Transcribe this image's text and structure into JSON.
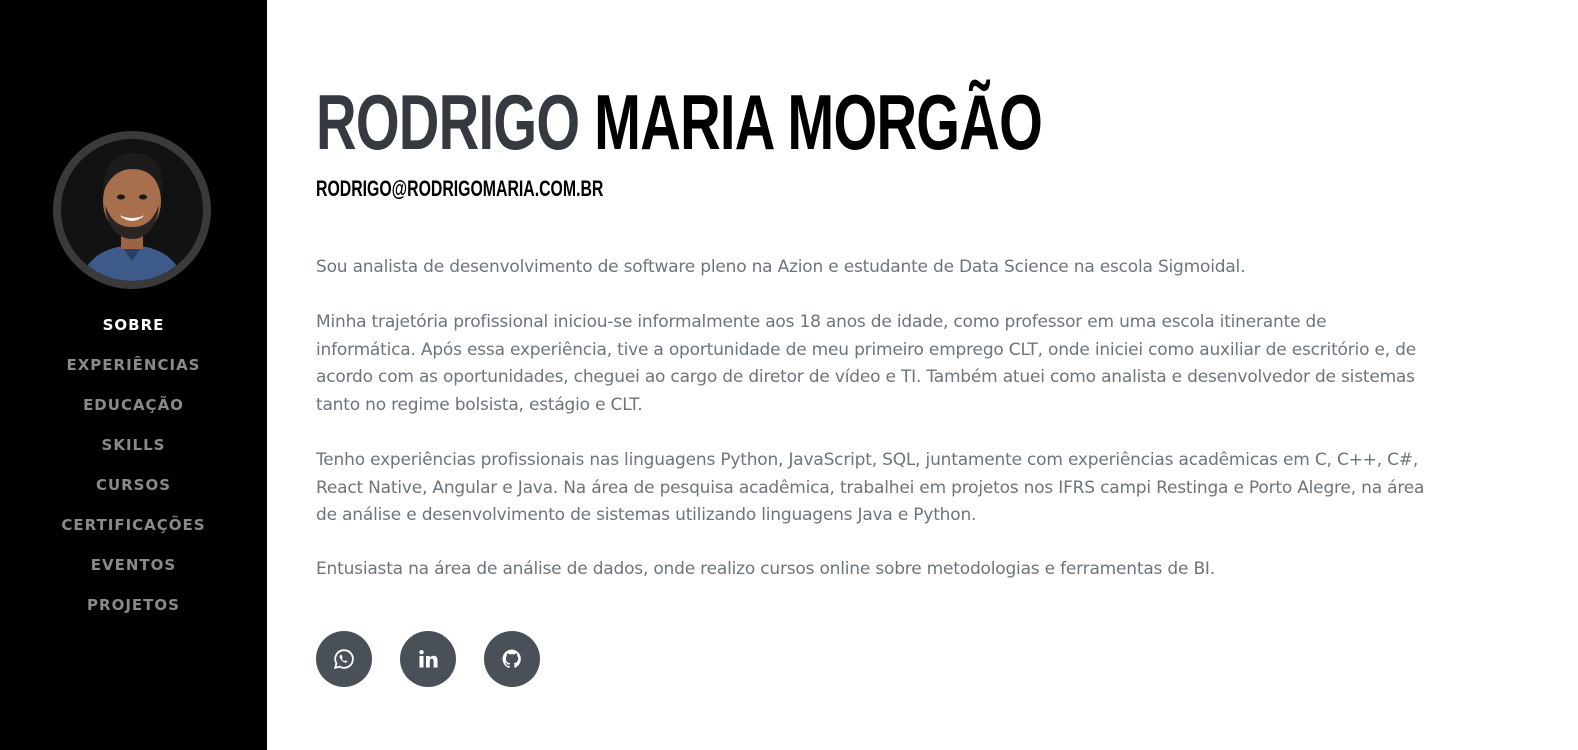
{
  "profile": {
    "first_name": "RODRIGO",
    "last_name": "MARIA MORGÃO",
    "email": "RODRIGO@RODRIGOMARIA.COM.BR",
    "avatar_alt": "Rodrigo Maria Morgão"
  },
  "nav": {
    "items": [
      {
        "label": "SOBRE",
        "active": true
      },
      {
        "label": "EXPERIÊNCIAS",
        "active": false
      },
      {
        "label": "EDUCAÇÃO",
        "active": false
      },
      {
        "label": "SKILLS",
        "active": false
      },
      {
        "label": "CURSOS",
        "active": false
      },
      {
        "label": "CERTIFICAÇÕES",
        "active": false
      },
      {
        "label": "EVENTOS",
        "active": false
      },
      {
        "label": "PROJETOS",
        "active": false
      }
    ]
  },
  "about": {
    "paragraphs": [
      "Sou analista de desenvolvimento de software pleno na Azion e estudante de Data Science na escola Sigmoidal.",
      "Minha trajetória profissional iniciou-se informalmente aos 18 anos de idade, como professor em uma escola itinerante de informática. Após essa experiência, tive a oportunidade de meu primeiro emprego CLT, onde iniciei como auxiliar de escritório e, de acordo com as oportunidades, cheguei ao cargo de diretor de vídeo e TI. Também atuei como analista e desenvolvedor de sistemas tanto no regime bolsista, estágio e CLT.",
      "Tenho experiências profissionais nas linguagens Python, JavaScript, SQL, juntamente com experiências acadêmicas em C, C++, C#, React Native, Angular e Java. Na área de pesquisa acadêmica, trabalhei em projetos nos IFRS campi Restinga e Porto Alegre, na área de análise e desenvolvimento de sistemas utilizando linguagens Java e Python.",
      "Entusiasta na área de análise de dados, onde realizo cursos online sobre metodologias e ferramentas de BI."
    ]
  },
  "social": [
    {
      "icon": "whatsapp-icon"
    },
    {
      "icon": "linkedin-icon"
    },
    {
      "icon": "github-icon"
    }
  ],
  "colors": {
    "sidebar_bg": "#000000",
    "nav_active": "#ffffff",
    "nav_inactive": "#8a8a8a",
    "name_first": "#343a40",
    "name_last": "#000000",
    "body_text": "#6c757d",
    "social_bg": "#495057"
  }
}
